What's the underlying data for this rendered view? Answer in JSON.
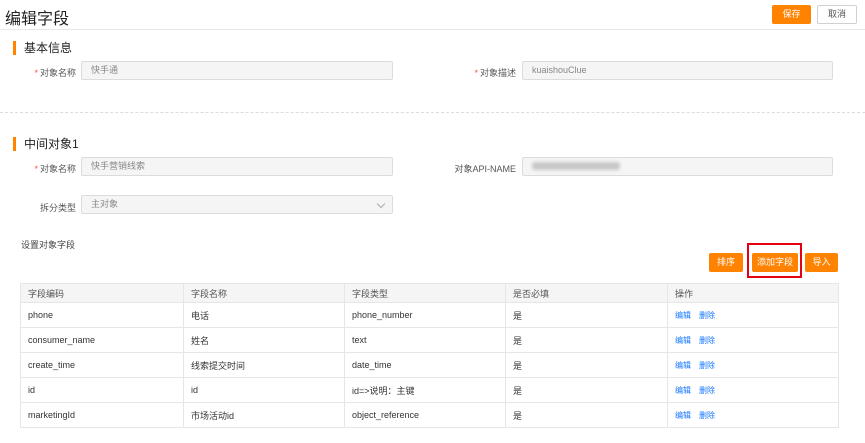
{
  "header": {
    "title": "编辑字段",
    "save_label": "保存",
    "cancel_label": "取消"
  },
  "basic_info": {
    "section_title": "基本信息",
    "object_name_label": "对象名称",
    "object_name_value": "快手通",
    "object_desc_label": "对象描述",
    "object_desc_value": "kuaishouClue"
  },
  "middle_object": {
    "section_title": "中间对象1",
    "object_name_label": "对象名称",
    "object_name_value": "快手营销线索",
    "api_name_label": "对象API-NAME",
    "split_type_label": "拆分类型",
    "split_type_value": "主对象"
  },
  "fields_section": {
    "label": "设置对象字段",
    "sort_label": "排序",
    "add_field_label": "添加字段",
    "import_label": "导入"
  },
  "table": {
    "columns": [
      "字段编码",
      "字段名称",
      "字段类型",
      "是否必填",
      "操作"
    ],
    "rows": [
      {
        "code": "phone",
        "name": "电话",
        "type": "phone_number",
        "required": "是"
      },
      {
        "code": "consumer_name",
        "name": "姓名",
        "type": "text",
        "required": "是"
      },
      {
        "code": "create_time",
        "name": "线索提交时间",
        "type": "date_time",
        "required": "是"
      },
      {
        "code": "id",
        "name": "id",
        "type": "id=>说明：主键",
        "required": "是"
      },
      {
        "code": "marketingId",
        "name": "市场活动id",
        "type": "object_reference",
        "required": "是"
      }
    ],
    "edit_label": "编辑",
    "delete_label": "删除"
  },
  "colors": {
    "accent": "#ff8200",
    "link": "#1677ff",
    "highlight": "#e60012",
    "required": "#ff4d4f"
  },
  "icons": {
    "select_arrow": "chevron-down-icon"
  }
}
